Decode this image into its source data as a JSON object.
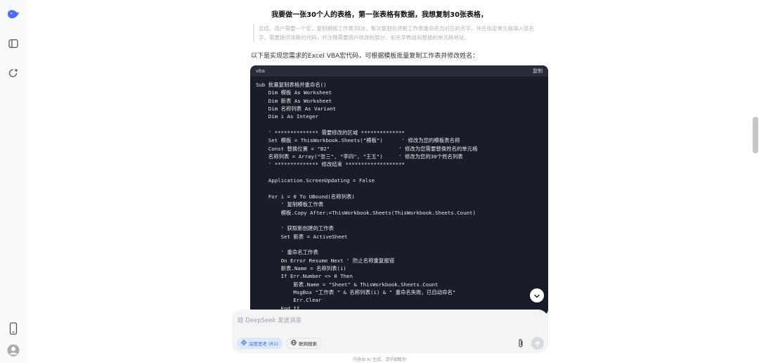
{
  "title": "我要做一张30个人的表格，第一张表格有数据，我想复制30张表格，",
  "quote_lines": [
    "总结。用户需要一个宏，复制模板工作表30次，每次复制后将新工作表重命名为对应的名字，并在指定单元格填入该名",
    "字。需要提供清晰的代码，并注释需要用户修改的部分，如名字数组和替换的单元格地址。"
  ],
  "intro": "以下是实现您需求的Excel VBA宏代码，可根据模板批量复制工作表并修改姓名：",
  "code": {
    "lang": "vba",
    "copy_label": "复制",
    "lines": [
      "Sub 批量复制表格并重命名()",
      "    Dim 模板 As Worksheet",
      "    Dim 新表 As Worksheet",
      "    Dim 名称列表 As Variant",
      "    Dim i As Integer",
      "",
      "    ' ************** 需要修改的区域 **************",
      "    Set 模板 = ThisWorkbook.Sheets(\"模板\")      ' 修改为您的模板表名称",
      "    Const 替换位置 = \"B2\"                      ' 修改为您需要替换姓名的单元格",
      "    名称列表 = Array(\"张三\", \"李四\", \"王五\")     ' 修改为您的30个姓名列表",
      "    ' ************** 修改结束 *******************",
      "",
      "    Application.ScreenUpdating = False",
      "",
      "    For i = 0 To UBound(名称列表)",
      "        ' 复制模板工作表",
      "        模板.Copy After:=ThisWorkbook.Sheets(ThisWorkbook.Sheets.Count)",
      "",
      "        ' 获取新创建的工作表",
      "        Set 新表 = ActiveSheet",
      "",
      "        ' 重命名工作表",
      "        On Error Resume Next ' 防止名称重复报错",
      "        新表.Name = 名称列表(i)",
      "        If Err.Number <> 0 Then",
      "            新表.Name = \"Sheet\" & ThisWorkbook.Sheets.Count",
      "            MsgBox \"工作表 \" & 名称列表(i) & \" 重命名失败，已自动命名\"",
      "            Err.Clear",
      "        End If"
    ]
  },
  "input": {
    "placeholder": "给 DeepSeek 发送消息",
    "deep_think_label": "深度思考 (R1)",
    "web_search_label": "联网搜索"
  },
  "footer": "内容由 AI 生成，请仔细甄别",
  "icons": {
    "logo": "deepseek-whale-icon",
    "sidebar_toggle": "sidebar-toggle-icon",
    "new_chat": "new-chat-icon",
    "phone": "phone-icon",
    "avatar": "user-avatar-icon",
    "attach": "paperclip-icon",
    "send": "send-arrow-icon",
    "scroll_down": "chevron-down-icon",
    "deep_think": "atom-icon",
    "web_search": "globe-icon"
  },
  "colors": {
    "brand": "#4d6bfe",
    "code_bg": "#181d27",
    "chip_active_bg": "#dbe8ff",
    "chip_active_text": "#3b6cd9"
  }
}
